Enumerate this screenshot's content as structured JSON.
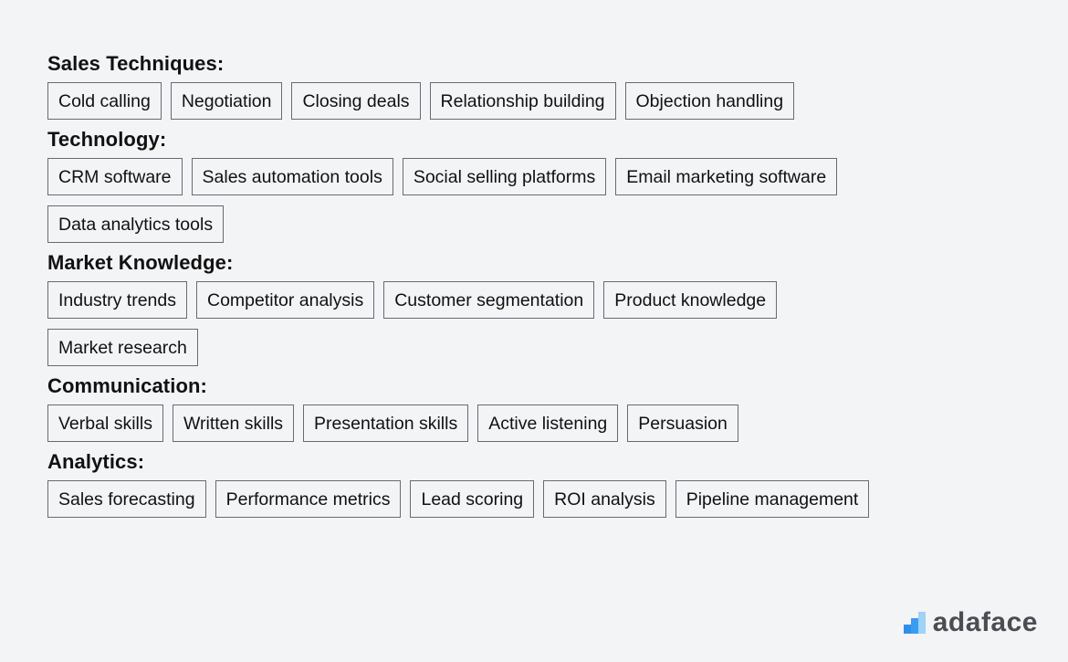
{
  "sections": [
    {
      "title": "Sales Techniques:",
      "tags": [
        "Cold calling",
        "Negotiation",
        "Closing deals",
        "Relationship building",
        "Objection handling"
      ]
    },
    {
      "title": "Technology:",
      "tags": [
        "CRM software",
        "Sales automation tools",
        "Social selling platforms",
        "Email marketing software",
        "Data analytics tools"
      ]
    },
    {
      "title": "Market Knowledge:",
      "tags": [
        "Industry trends",
        "Competitor analysis",
        "Customer segmentation",
        "Product knowledge",
        "Market research"
      ]
    },
    {
      "title": "Communication:",
      "tags": [
        "Verbal skills",
        "Written skills",
        "Presentation skills",
        "Active listening",
        "Persuasion"
      ]
    },
    {
      "title": "Analytics:",
      "tags": [
        "Sales forecasting",
        "Performance metrics",
        "Lead scoring",
        "ROI analysis",
        "Pipeline management"
      ]
    }
  ],
  "logo": {
    "text": "adaface",
    "icon": "bar-chart-logo-icon",
    "colors": [
      "#2f8fe8",
      "#7cc0f3"
    ]
  }
}
